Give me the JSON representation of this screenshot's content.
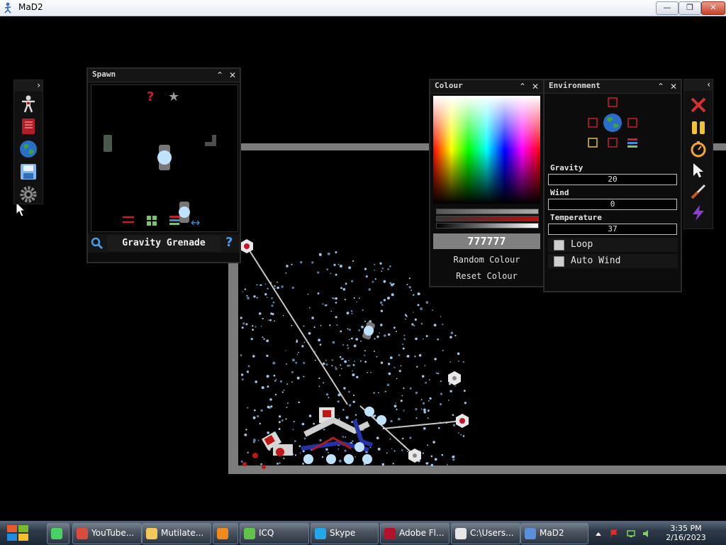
{
  "window": {
    "title": "MaD2",
    "minimize": "—",
    "maximize": "❐",
    "close": "✕"
  },
  "left_toolbar": {
    "toggle": "›",
    "tools": [
      {
        "name": "ragdoll-icon"
      },
      {
        "name": "book-icon"
      },
      {
        "name": "globe-icon"
      },
      {
        "name": "save-icon"
      },
      {
        "name": "gear-icon"
      }
    ]
  },
  "spawn": {
    "title": "Spawn",
    "collapse": "⌃",
    "close": "✕",
    "selected_item": "Gravity Grenade",
    "search_icon": "magnifier-icon",
    "help": "?"
  },
  "colour": {
    "title": "Colour",
    "collapse": "⌃",
    "close": "✕",
    "hex": "777777",
    "random_label": "Random Colour",
    "reset_label": "Reset Colour"
  },
  "environment": {
    "title": "Environment",
    "collapse": "⌃",
    "close": "✕",
    "gravity_label": "Gravity",
    "gravity_value": "20",
    "wind_label": "Wind",
    "wind_value": "0",
    "temperature_label": "Temperature",
    "temperature_value": "37",
    "loop_label": "Loop",
    "auto_wind_label": "Auto Wind"
  },
  "right_toolbar": {
    "toggle": "‹",
    "tools": [
      {
        "name": "delete-x-icon"
      },
      {
        "name": "pause-icon"
      },
      {
        "name": "stopwatch-icon"
      },
      {
        "name": "cursor-icon"
      },
      {
        "name": "knife-icon"
      },
      {
        "name": "lightning-icon"
      }
    ]
  },
  "taskbar": {
    "items": [
      {
        "label": "",
        "icon": "chat-icon"
      },
      {
        "label": "YouTube...",
        "icon": "chrome-icon"
      },
      {
        "label": "Mutilate...",
        "icon": "folder-icon"
      },
      {
        "label": "",
        "icon": "vlc-icon"
      },
      {
        "label": "ICQ",
        "icon": "icq-icon"
      },
      {
        "label": "Skype",
        "icon": "skype-icon"
      },
      {
        "label": "Adobe Fl...",
        "icon": "flash-icon"
      },
      {
        "label": "C:\\Users...",
        "icon": "7zip-icon"
      },
      {
        "label": "MaD2",
        "icon": "mad2-icon"
      }
    ],
    "time": "3:35 PM",
    "date": "2/16/2023"
  }
}
